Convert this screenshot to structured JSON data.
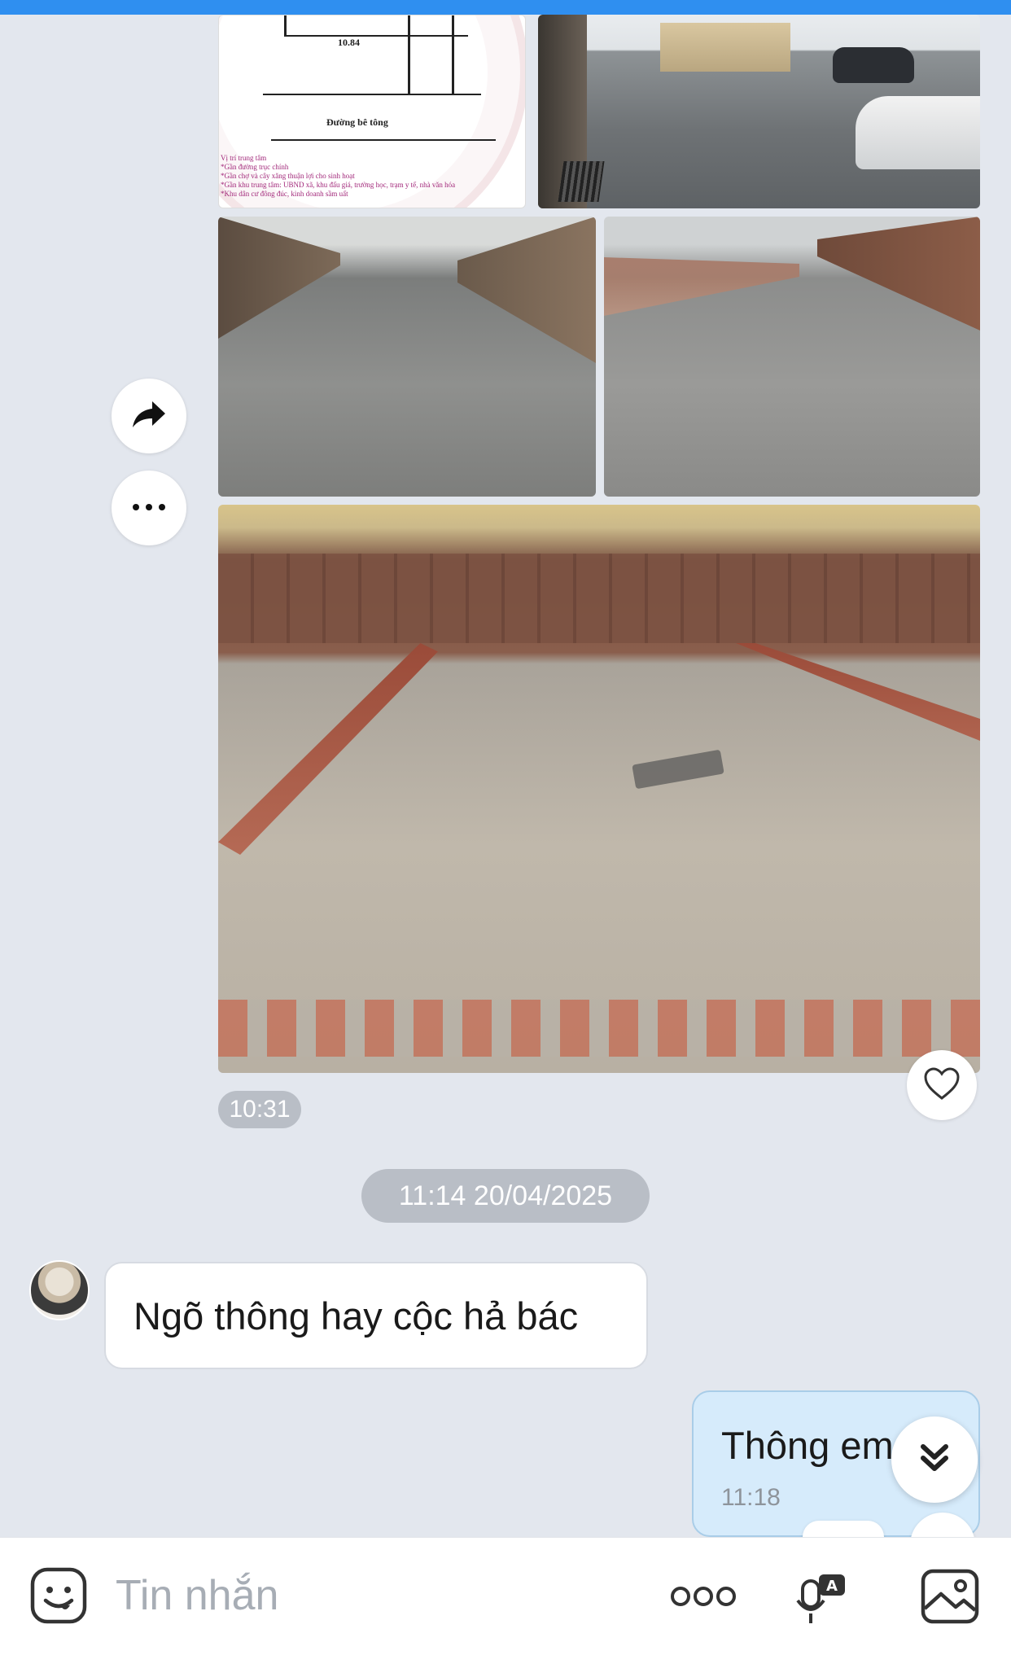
{
  "app": {
    "top_strip_color": "#2f8ff0"
  },
  "images": {
    "floor_plan": {
      "dimension_label": "10.84",
      "road_label": "Đường bê tông",
      "notes": [
        "Vị trí trung tâm",
        "*Gần đường trục chính",
        "*Gần chợ và cây xăng thuận lợi cho sinh hoạt",
        "*Gần khu trung tâm: UBND xã, khu đấu giá, trường học, trạm y tế, nhà văn hóa",
        "*Khu dân cư đông đúc, kinh doanh sầm uất"
      ]
    }
  },
  "message_group": {
    "time": "10:31"
  },
  "date_separator": "11:14 20/04/2025",
  "incoming_message": {
    "text": "Ngõ thông hay cộc hả bác"
  },
  "outgoing_message": {
    "text": "Thông em",
    "time": "11:18"
  },
  "composer": {
    "placeholder": "Tin nhắn"
  },
  "colors": {
    "background": "#e3e7ee",
    "outgoing_bubble": "#d6ebfb",
    "incoming_bubble": "#ffffff",
    "time_pill": "#b9bec6"
  },
  "icons": [
    "share-icon",
    "more-icon",
    "heart-icon",
    "chevrons-down-icon",
    "emoji-icon",
    "dots-icon",
    "mic-translate-icon",
    "image-icon"
  ]
}
